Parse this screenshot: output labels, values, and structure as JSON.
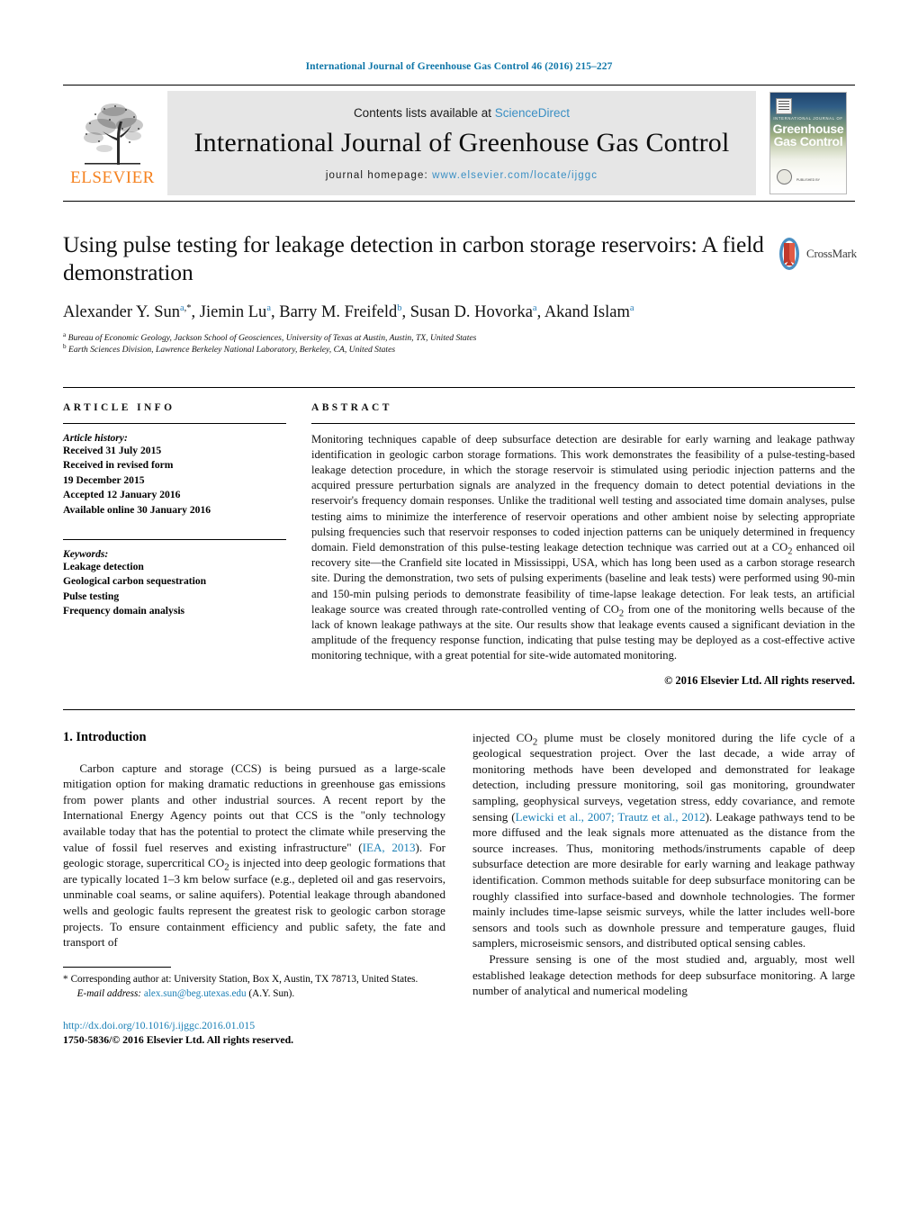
{
  "running_head": "International Journal of Greenhouse Gas Control 46 (2016) 215–227",
  "masthead": {
    "publisher_name": "ELSEVIER",
    "contents_prefix": "Contents lists available at ",
    "contents_link": "ScienceDirect",
    "journal_title": "International Journal of Greenhouse Gas Control",
    "homepage_prefix": "journal homepage: ",
    "homepage_url": "www.elsevier.com/locate/ijggc",
    "cover": {
      "kicker": "INTERNATIONAL JOURNAL OF",
      "line1": "Greenhouse",
      "line2": "Gas Control",
      "footer": "PUBLISHED BY"
    }
  },
  "article": {
    "title": "Using pulse testing for leakage detection in carbon storage reservoirs: A field demonstration",
    "crossmark_label": "CrossMark",
    "authors_html": "Alexander Y. Sun<sup class=\"aff\">a</sup><sup class=\"star\">,*</sup>, Jiemin Lu<sup class=\"aff\">a</sup>, Barry M. Freifeld<sup class=\"aff\">b</sup>, Susan D. Hovorka<sup class=\"aff\">a</sup>, Akand Islam<sup class=\"aff\">a</sup>",
    "affiliation_a": "Bureau of Economic Geology, Jackson School of Geosciences, University of Texas at Austin, Austin, TX, United States",
    "affiliation_b": "Earth Sciences Division, Lawrence Berkeley National Laboratory, Berkeley, CA, United States"
  },
  "article_info": {
    "heading": "ARTICLE INFO",
    "history_label": "Article history:",
    "history": [
      "Received 31 July 2015",
      "Received in revised form",
      "19 December 2015",
      "Accepted 12 January 2016",
      "Available online 30 January 2016"
    ],
    "keywords_label": "Keywords:",
    "keywords": [
      "Leakage detection",
      "Geological carbon sequestration",
      "Pulse testing",
      "Frequency domain analysis"
    ]
  },
  "abstract": {
    "heading": "ABSTRACT",
    "text": "Monitoring techniques capable of deep subsurface detection are desirable for early warning and leakage pathway identification in geologic carbon storage formations. This work demonstrates the feasibility of a pulse-testing-based leakage detection procedure, in which the storage reservoir is stimulated using periodic injection patterns and the acquired pressure perturbation signals are analyzed in the frequency domain to detect potential deviations in the reservoir's frequency domain responses. Unlike the traditional well testing and associated time domain analyses, pulse testing aims to minimize the interference of reservoir operations and other ambient noise by selecting appropriate pulsing frequencies such that reservoir responses to coded injection patterns can be uniquely determined in frequency domain. Field demonstration of this pulse-testing leakage detection technique was carried out at a CO2 enhanced oil recovery site—the Cranfield site located in Mississippi, USA, which has long been used as a carbon storage research site. During the demonstration, two sets of pulsing experiments (baseline and leak tests) were performed using 90-min and 150-min pulsing periods to demonstrate feasibility of time-lapse leakage detection. For leak tests, an artificial leakage source was created through rate-controlled venting of CO2 from one of the monitoring wells because of the lack of known leakage pathways at the site. Our results show that leakage events caused a significant deviation in the amplitude of the frequency response function, indicating that pulse testing may be deployed as a cost-effective active monitoring technique, with a great potential for site-wide automated monitoring.",
    "copyright": "© 2016 Elsevier Ltd. All rights reserved."
  },
  "body": {
    "section_number_title": "1.  Introduction",
    "left_paragraph_1": "Carbon capture and storage (CCS) is being pursued as a large-scale mitigation option for making dramatic reductions in greenhouse gas emissions from power plants and other industrial sources. A recent report by the International Energy Agency points out that CCS is the \"only technology available today that has the potential to protect the climate while preserving the value of fossil fuel reserves and existing infrastructure\" (",
    "left_ref_1": "IEA, 2013",
    "left_paragraph_1_cont": "). For geologic storage, supercritical CO2 is injected into deep geologic formations that are typically located 1–3 km below surface (e.g., depleted oil and gas reservoirs, unminable coal seams, or saline aquifers). Potential leakage through abandoned wells and geologic faults represent the greatest risk to geologic carbon storage projects. To ensure containment efficiency and public safety, the fate and transport of",
    "right_paragraph_1": "injected CO2 plume must be closely monitored during the life cycle of a geological sequestration project. Over the last decade, a wide array of monitoring methods have been developed and demonstrated for leakage detection, including pressure monitoring, soil gas monitoring, groundwater sampling, geophysical surveys, vegetation stress, eddy covariance, and remote sensing (",
    "right_ref_1": "Lewicki et al., 2007; Trautz et al., 2012",
    "right_paragraph_1_cont": "). Leakage pathways tend to be more diffused and the leak signals more attenuated as the distance from the source increases. Thus, monitoring methods/instruments capable of deep subsurface detection are more desirable for early warning and leakage pathway identification. Common methods suitable for deep subsurface monitoring can be roughly classified into surface-based and downhole technologies. The former mainly includes time-lapse seismic surveys, while the latter includes well-bore sensors and tools such as downhole pressure and temperature gauges, fluid samplers, microseismic sensors, and distributed optical sensing cables.",
    "right_paragraph_2": "Pressure sensing is one of the most studied and, arguably, most well established leakage detection methods for deep subsurface monitoring. A large number of analytical and numerical modeling"
  },
  "footnote": {
    "star": "*",
    "corresponding": "Corresponding author at: University Station, Box X, Austin, TX 78713, United States.",
    "email_label": "E-mail address:",
    "email": "alex.sun@beg.utexas.edu",
    "email_suffix": "(A.Y. Sun).",
    "doi": "http://dx.doi.org/10.1016/j.ijggc.2016.01.015",
    "issn_line": "1750-5836/© 2016 Elsevier Ltd. All rights reserved."
  },
  "colors": {
    "link_blue": "#1a7fb5",
    "runhead_blue": "#0e76a8",
    "elsevier_orange": "#f58220",
    "banner_gray": "#e6e6e6"
  }
}
